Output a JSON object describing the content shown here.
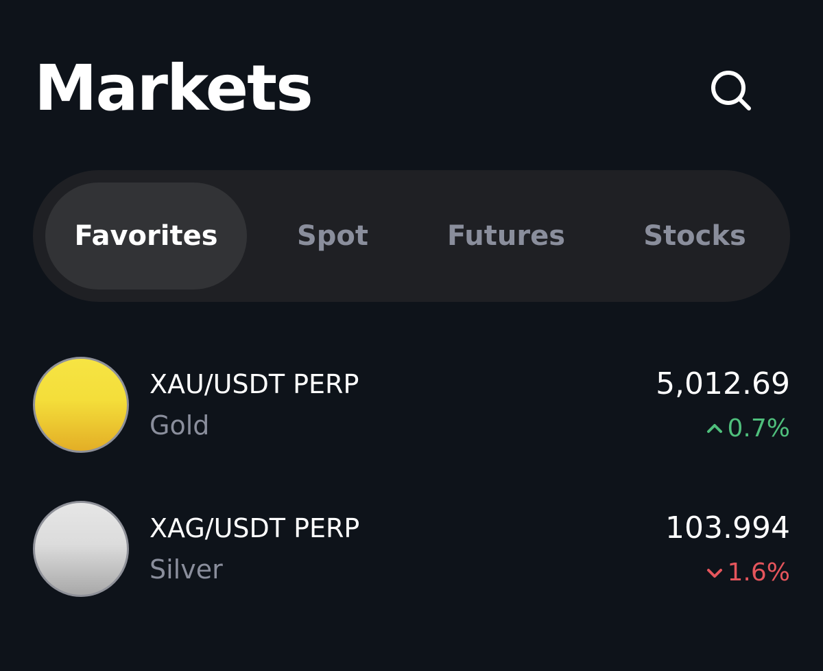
{
  "header": {
    "title": "Markets",
    "search_icon": "search-icon"
  },
  "tabs": [
    {
      "label": "Favorites",
      "active": true
    },
    {
      "label": "Spot",
      "active": false
    },
    {
      "label": "Futures",
      "active": false
    },
    {
      "label": "Stocks",
      "active": false
    }
  ],
  "markets": [
    {
      "symbol": "XAU/USDT PERP",
      "name": "Gold",
      "price": "5,012.69",
      "change": "0.7%",
      "direction": "up",
      "change_color": "#4fbf7c",
      "coin_icon": "gold-coin-icon"
    },
    {
      "symbol": "XAG/USDT PERP",
      "name": "Silver",
      "price": "103.994",
      "change": "1.6%",
      "direction": "down",
      "change_color": "#e5555c",
      "coin_icon": "silver-coin-icon"
    }
  ],
  "colors": {
    "background": "#0e131a",
    "tab_bar": "#1f2024",
    "tab_active": "#323336",
    "text_muted": "#8a8e9c"
  }
}
